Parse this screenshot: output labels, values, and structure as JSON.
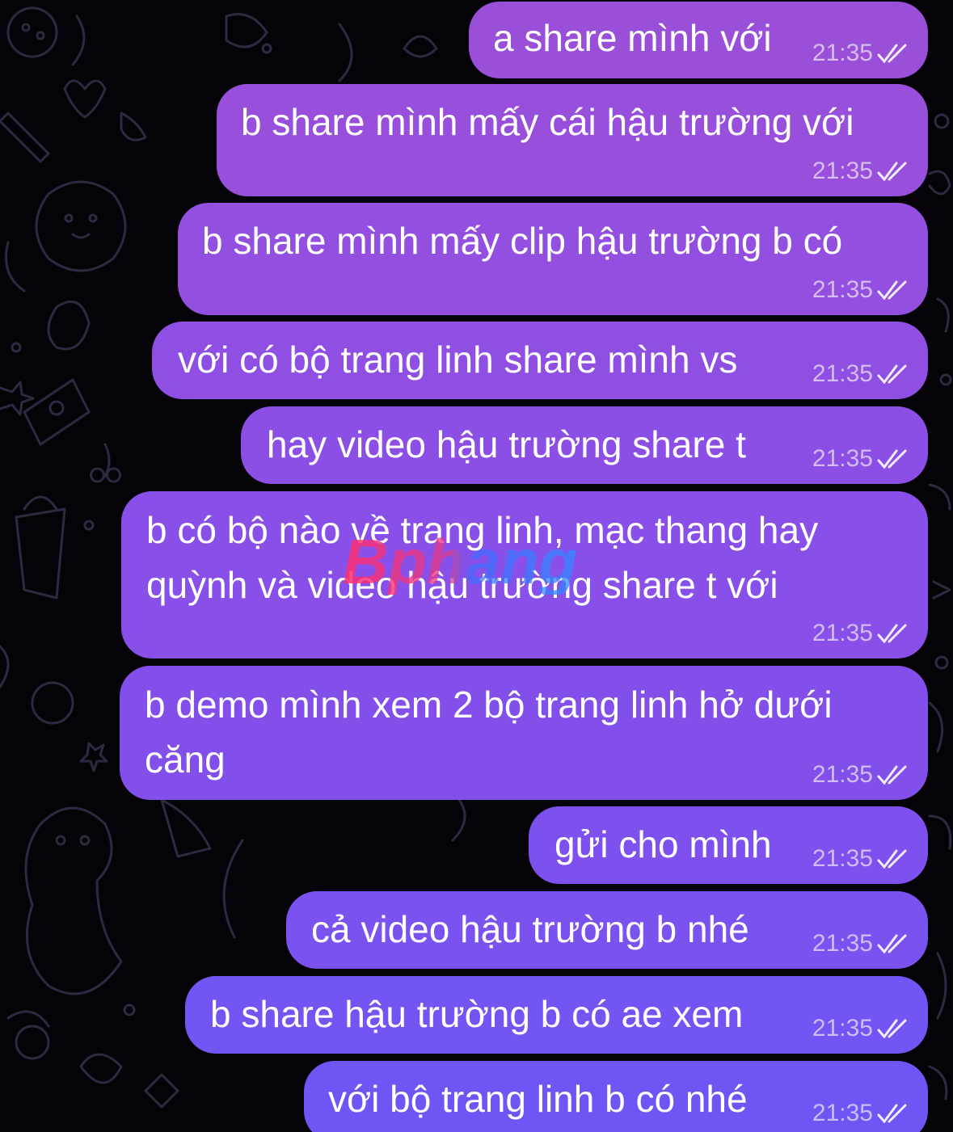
{
  "chat": {
    "watermark_text": "Bphang",
    "messages": [
      {
        "text": "a share mình với",
        "time": "21:35",
        "status_icon": "double-check-icon",
        "color": "#9a4fd8"
      },
      {
        "text": "b share mình mấy cái hậu trường với",
        "time": "21:35",
        "status_icon": "double-check-icon",
        "color": "#984fdb"
      },
      {
        "text": "b share mình mấy clip hậu trường b có",
        "time": "21:35",
        "status_icon": "double-check-icon",
        "color": "#934fe0"
      },
      {
        "text": "với có bộ trang linh share mình vs",
        "time": "21:35",
        "status_icon": "double-check-icon",
        "color": "#8f4fe3"
      },
      {
        "text": "hay video hậu trường share t",
        "time": "21:35",
        "status_icon": "double-check-icon",
        "color": "#8c4fe6"
      },
      {
        "text": "b có bộ nào về trang linh, mạc thang hay\nquỳnh và video hậu trường share t với",
        "time": "21:35",
        "status_icon": "double-check-icon",
        "color": "#884fe9"
      },
      {
        "text": "b demo mình xem 2 bộ trang linh hở dưới\ncăng",
        "time": "21:35",
        "status_icon": "double-check-icon",
        "color": "#834feb"
      },
      {
        "text": "gửi cho mình",
        "time": "21:35",
        "status_icon": "double-check-icon",
        "color": "#7e50ee"
      },
      {
        "text": "cả video hậu trường b nhé",
        "time": "21:35",
        "status_icon": "double-check-icon",
        "color": "#7a52f0"
      },
      {
        "text": "b share hậu trường b có ae xem",
        "time": "21:35",
        "status_icon": "double-check-icon",
        "color": "#7454f3"
      },
      {
        "text": "với bộ trang linh b có nhé",
        "time": "21:35",
        "status_icon": "double-check-icon",
        "color": "#6e56f5"
      }
    ]
  }
}
